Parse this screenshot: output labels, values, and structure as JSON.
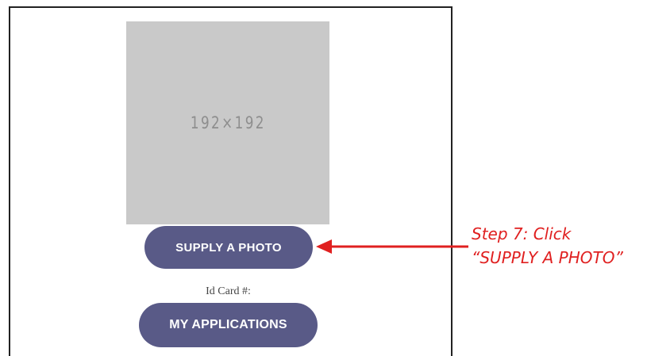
{
  "image_placeholder": {
    "text": "192×192"
  },
  "buttons": {
    "supply_photo_label": "SUPPLY A PHOTO",
    "my_applications_label": "MY APPLICATIONS"
  },
  "id_card": {
    "label": "Id Card #:"
  },
  "annotation": {
    "line1": "Step 7: Click",
    "line2": "“SUPPLY A PHOTO”",
    "color": "#e02020"
  },
  "colors": {
    "button_bg": "#595a87",
    "placeholder_bg": "#c9c9c9"
  },
  "icons": {
    "pointer": "left-arrow-icon"
  }
}
